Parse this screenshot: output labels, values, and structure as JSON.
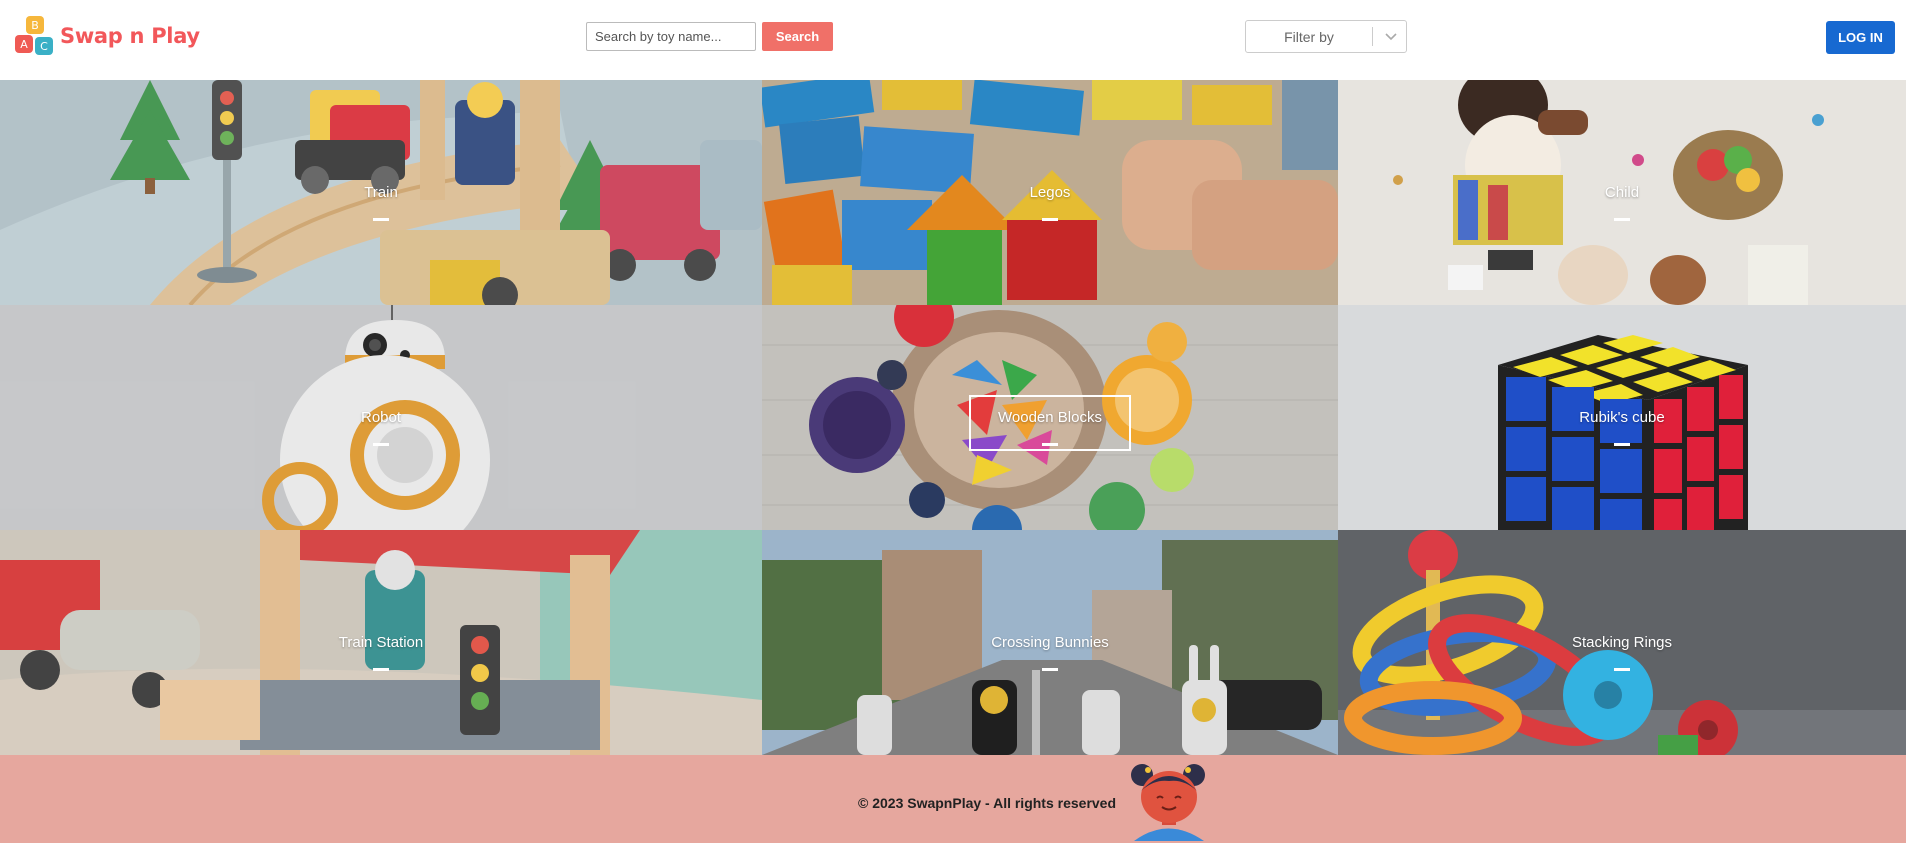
{
  "header": {
    "logo_text": "Swap n Play",
    "logo_letters": [
      "B",
      "A",
      "C"
    ],
    "search_placeholder": "Search by toy name...",
    "search_button": "Search",
    "filter_label": "Filter by",
    "login_button": "LOG IN"
  },
  "tiles": [
    {
      "title": "Train"
    },
    {
      "title": "Legos"
    },
    {
      "title": "Child"
    },
    {
      "title": "Robot"
    },
    {
      "title": "Wooden Blocks"
    },
    {
      "title": "Rubik's cube"
    },
    {
      "title": "Train Station"
    },
    {
      "title": "Crossing Bunnies"
    },
    {
      "title": "Stacking Rings"
    }
  ],
  "footer": {
    "copyright": "© 2023 SwapnPlay - All rights reserved"
  },
  "colors": {
    "brand": "#f2575a",
    "search_button": "#f07068",
    "login_button": "#1769d1",
    "footer_bg": "#e6a79e"
  }
}
